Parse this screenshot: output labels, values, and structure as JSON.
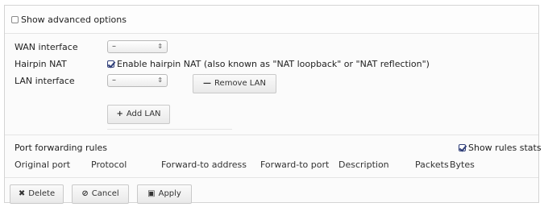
{
  "advanced": {
    "label": "Show advanced options"
  },
  "wan": {
    "label": "WAN interface",
    "select_value": "–"
  },
  "hairpin": {
    "label": "Hairpin NAT",
    "checkbox_label": "Enable hairpin NAT (also known as \"NAT loopback\" or \"NAT reflection\")"
  },
  "lan": {
    "label": "LAN interface",
    "select_value": "–",
    "remove_label": "Remove LAN",
    "add_label": "Add LAN"
  },
  "port_forwarding": {
    "title": "Port forwarding rules",
    "show_stats_label": "Show rules stats",
    "columns": [
      "Original port",
      "Protocol",
      "Forward-to address",
      "Forward-to port",
      "Description",
      "Packets",
      "Bytes"
    ]
  },
  "actions": {
    "delete_label": "Delete",
    "cancel_label": "Cancel",
    "apply_label": "Apply"
  },
  "icons": {
    "select_arrows": "updown-icon",
    "remove": "minus-icon",
    "add": "plus-icon",
    "delete": "x-icon",
    "cancel": "ban-icon",
    "apply": "save-icon"
  }
}
